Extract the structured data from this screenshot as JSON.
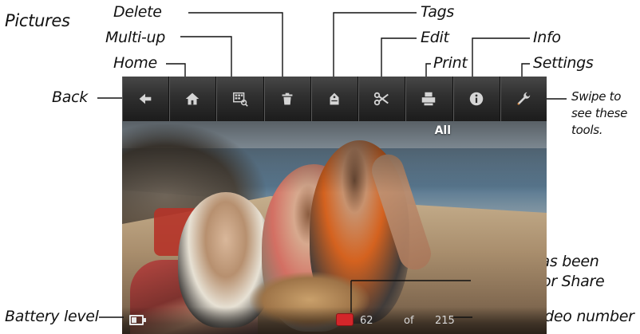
{
  "heading": "Pictures",
  "labels": {
    "delete": "Delete",
    "multiup": "Multi-up",
    "home": "Home",
    "back": "Back",
    "tags": "Tags",
    "edit": "Edit",
    "print": "Print",
    "info": "Info",
    "settings": "Settings",
    "swipe": "Swipe to see these tools.",
    "share_marked": "Picture has been marked for Share",
    "battery": "Battery level",
    "picture_number": "Picture/video number"
  },
  "screen": {
    "filter_label": "All",
    "current": "62",
    "of": "of",
    "total": "215"
  },
  "toolbar": [
    {
      "icon": "back-arrow-icon"
    },
    {
      "icon": "home-icon"
    },
    {
      "icon": "multi-up-icon"
    },
    {
      "icon": "trash-icon"
    },
    {
      "icon": "tag-icon"
    },
    {
      "icon": "scissors-icon"
    },
    {
      "icon": "printer-icon"
    },
    {
      "icon": "info-icon"
    },
    {
      "icon": "wrench-icon"
    }
  ],
  "colors": {
    "share_badge": "#d3262a",
    "toolbar_top": "#474747",
    "toolbar_bottom": "#1c1c1c"
  }
}
